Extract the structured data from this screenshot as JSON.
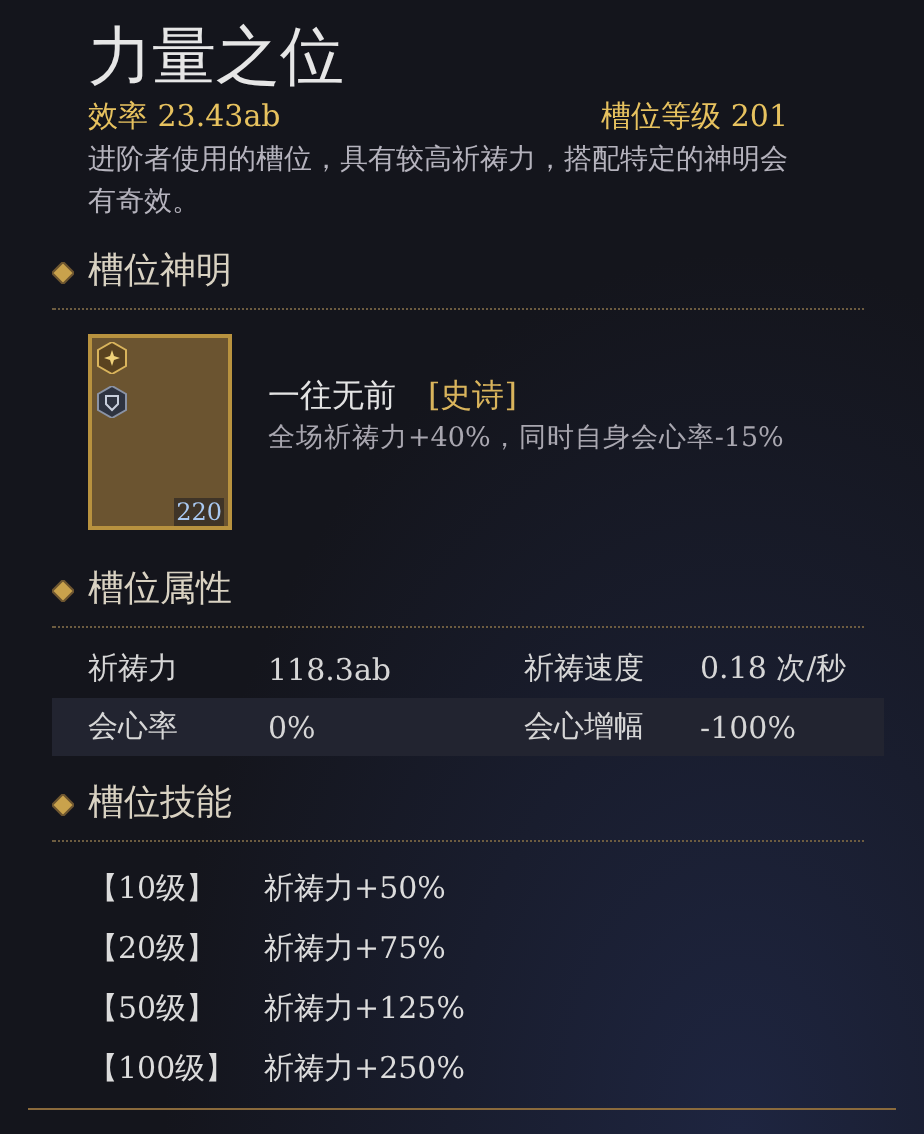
{
  "title": "力量之位",
  "efficiency": "效率 23.43ab",
  "slot_level": "槽位等级 201",
  "description": "进阶者使用的槽位，具有较高祈祷力，搭配特定的神明会有奇效。",
  "deity_section": {
    "heading": "槽位神明",
    "card": {
      "level": "220"
    },
    "name": "一往无前",
    "rarity": "[史诗]",
    "effect": "全场祈祷力+40%，同时自身会心率-15%"
  },
  "attributes_section": {
    "heading": "槽位属性",
    "rows": [
      {
        "label_1": "祈祷力",
        "value_1": "118.3ab",
        "label_2": "祈祷速度",
        "value_2": "0.18 次/秒"
      },
      {
        "label_1": "会心率",
        "value_1": "0%",
        "label_2": "会心增幅",
        "value_2": "-100%"
      }
    ]
  },
  "skills_section": {
    "heading": "槽位技能",
    "rows": [
      {
        "level": "【10级】",
        "effect": "祈祷力+50%"
      },
      {
        "level": "【20级】",
        "effect": "祈祷力+75%"
      },
      {
        "level": "【50级】",
        "effect": "祈祷力+125%"
      },
      {
        "level": "【100级】",
        "effect": "祈祷力+250%"
      }
    ]
  }
}
